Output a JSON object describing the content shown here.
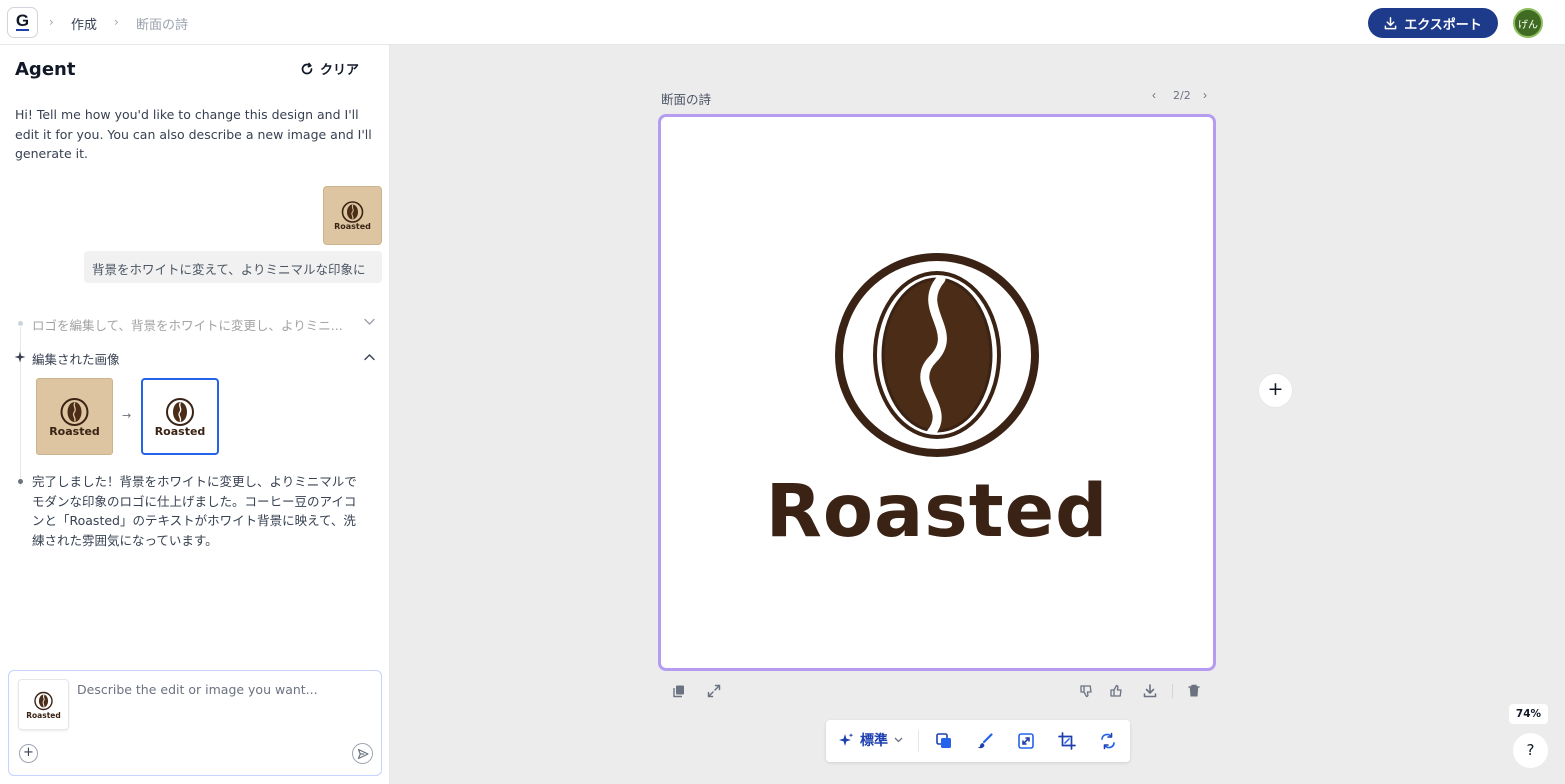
{
  "header": {
    "logo_letter": "G",
    "breadcrumb": [
      "作成",
      "断面の詩"
    ],
    "export_label": "エクスポート",
    "avatar_label": "げん"
  },
  "sidebar": {
    "title": "Agent",
    "clear_label": "クリア",
    "intro": "Hi! Tell me how you'd like to change this design and I'll edit it for you. You can also describe a new image and I'll generate it.",
    "user_message": "背景をホワイトに変えて、よりミニマルな印象に",
    "step_collapsed": "ロゴを編集して、背景をホワイトに変更し、よりミニ...",
    "step_edited": "編集された画像",
    "done_message": "完了しました！背景をホワイトに変更し、よりミニマルでモダンな印象のロゴに仕上げました。コーヒー豆のアイコンと「Roasted」のテキストがホワイト背景に映えて、洗練された雰囲気になっています。",
    "thumb_label": "Roasted",
    "input_placeholder": "Describe the edit or image you want..."
  },
  "canvas": {
    "title": "断面の詩",
    "page_indicator": "2/2",
    "wordmark": "Roasted",
    "mode_label": "標準",
    "zoom": "74%",
    "help": "?"
  },
  "colors": {
    "accent": "#1e3a8a",
    "artboard_border": "#b69cf0",
    "coffee_brown": "#3a2315",
    "bean_brown": "#4a2c17",
    "thumb_bg": "#dcc5a0"
  },
  "icons": [
    "chevron-right-icon",
    "download-icon",
    "refresh-icon",
    "arrow-right-icon",
    "chevron-down-icon",
    "chevron-up-icon",
    "sparkle-icon",
    "plus-icon",
    "send-icon",
    "copy-icon",
    "expand-icon",
    "thumbs-down-icon",
    "thumbs-up-icon",
    "trash-icon",
    "layers-icon",
    "brush-icon",
    "resize-icon",
    "crop-icon",
    "swap-icon"
  ]
}
